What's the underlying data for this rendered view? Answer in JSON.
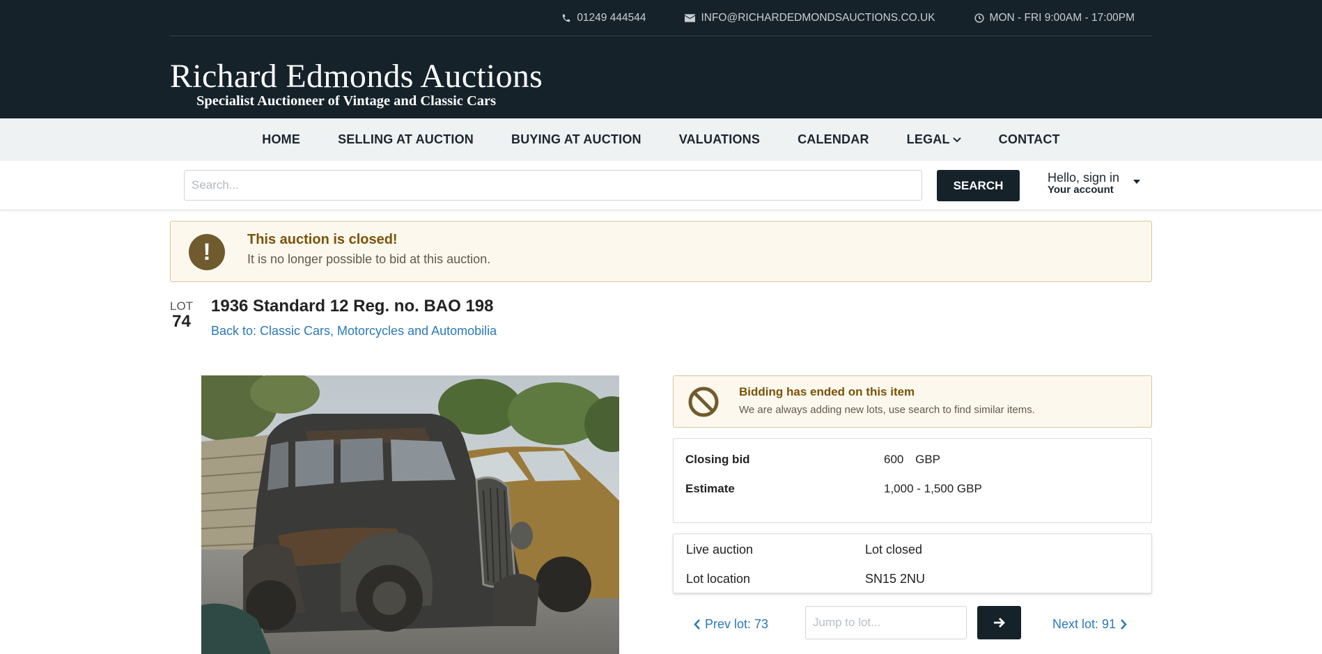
{
  "topbar": {
    "phone": "01249 444544",
    "email": "INFO@RICHARDEDMONDSAUCTIONS.CO.UK",
    "hours": "MON - FRI 9:00AM - 17:00PM",
    "icons": [
      "phone-icon",
      "envelope-icon",
      "clock-icon"
    ]
  },
  "logo": {
    "title": "Richard Edmonds Auctions",
    "subtitle": "Specialist Auctioneer of Vintage and Classic Cars"
  },
  "nav": {
    "items": [
      "HOME",
      "SELLING AT AUCTION",
      "BUYING AT AUCTION",
      "VALUATIONS",
      "CALENDAR",
      "LEGAL",
      "CONTACT"
    ]
  },
  "search": {
    "placeholder": "Search...",
    "button": "SEARCH"
  },
  "account": {
    "hello": "Hello, sign in",
    "label": "Your account"
  },
  "closed_alert": {
    "title": "This auction is closed!",
    "message": "It is no longer possible to bid at this auction."
  },
  "lot": {
    "label": "LOT",
    "number": "74",
    "title": "1936 Standard 12 Reg. no. BAO 198",
    "back_link": "Back to: Classic Cars, Motorcycles and Automobilia"
  },
  "bidding_notice": {
    "title": "Bidding has ended on this item",
    "message": "We are always adding new lots, use search to find similar items."
  },
  "bid_info": {
    "closing_bid_label": "Closing bid",
    "closing_bid_value": "600",
    "closing_bid_currency": "GBP",
    "estimate_label": "Estimate",
    "estimate_value": "1,000 - 1,500 GBP"
  },
  "status": {
    "live_label": "Live auction",
    "live_value": "Lot closed",
    "location_label": "Lot location",
    "location_value": "SN15 2NU"
  },
  "pager": {
    "prev": "Prev lot: 73",
    "jump_placeholder": "Jump to lot...",
    "next": "Next lot: 91"
  },
  "colors": {
    "header_bg": "#16222a",
    "nav_bg": "#eef2f3",
    "alert_bg": "#fdf8ee",
    "alert_title": "#7a5208",
    "link": "#2a78b8"
  }
}
